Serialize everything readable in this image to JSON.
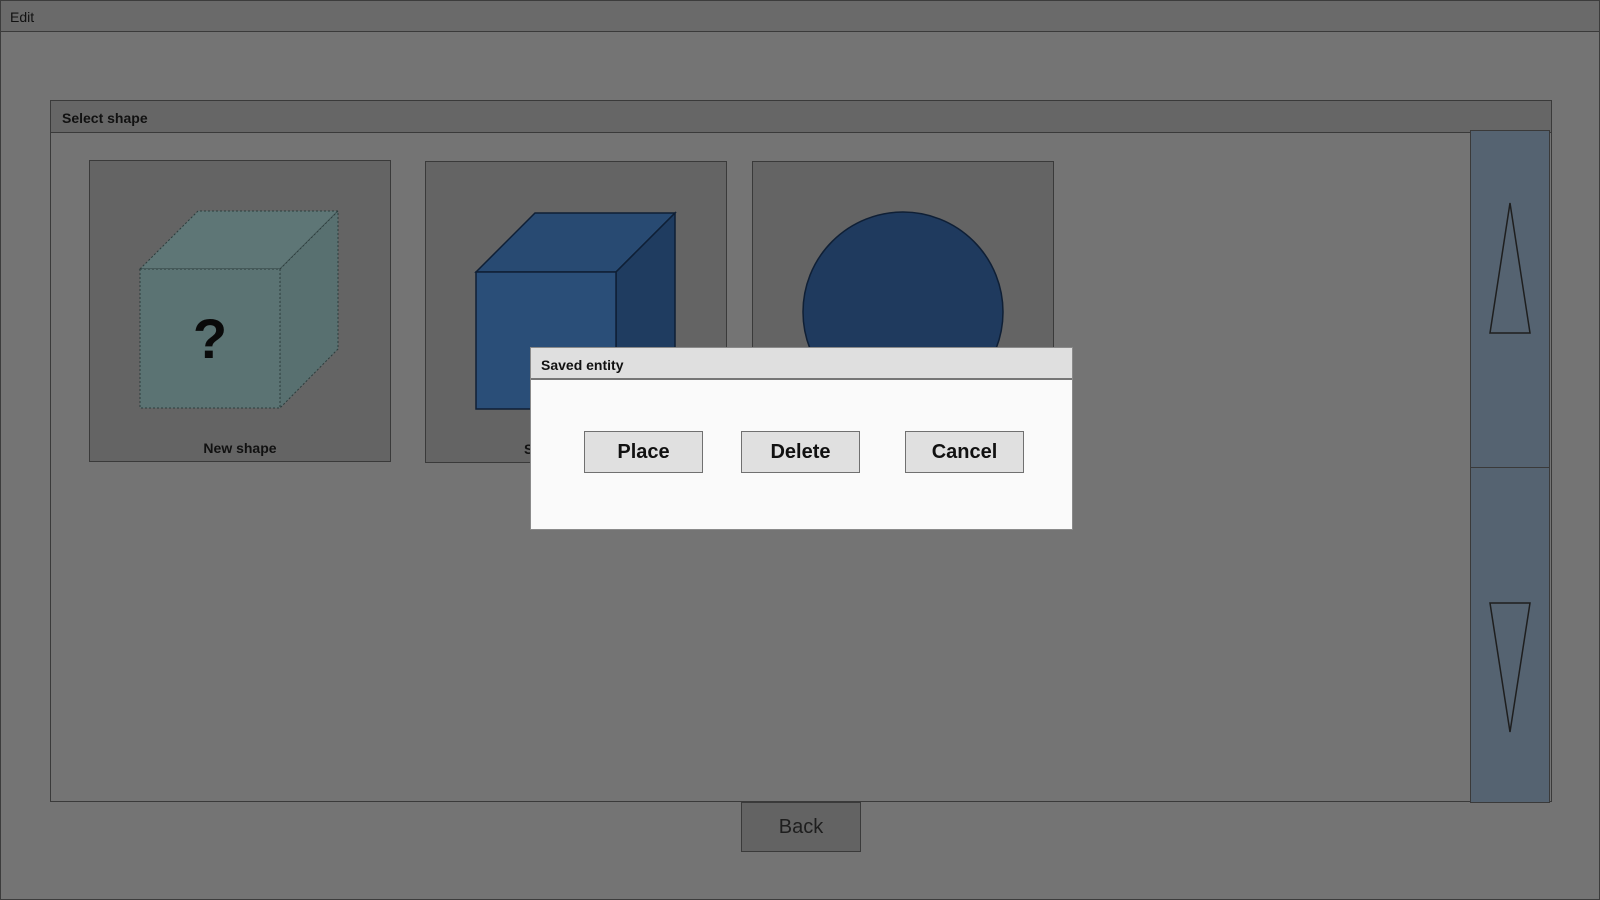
{
  "window": {
    "title": "Edit"
  },
  "panel": {
    "header": "Select shape",
    "tiles": [
      {
        "caption": "New shape",
        "icon": "unknown-cube-icon",
        "glyph": "?"
      },
      {
        "caption": "S",
        "icon": "cube-icon"
      },
      {
        "caption": "",
        "icon": "sphere-icon"
      }
    ]
  },
  "scrollbar": {
    "up_icon": "scroll-up-arrow-icon",
    "down_icon": "scroll-down-arrow-icon"
  },
  "footer": {
    "back_label": "Back"
  },
  "dialog": {
    "title": "Saved entity",
    "place_label": "Place",
    "delete_label": "Delete",
    "cancel_label": "Cancel"
  },
  "colors": {
    "background": "#747474",
    "tile": "#646464",
    "new_shape_fill": "#5b7373",
    "cube_front": "#2a4e78",
    "cube_side": "#1f3c60",
    "sphere": "#1f3a5e",
    "scrollbar": "#556371",
    "dialog": "#fafafa"
  }
}
